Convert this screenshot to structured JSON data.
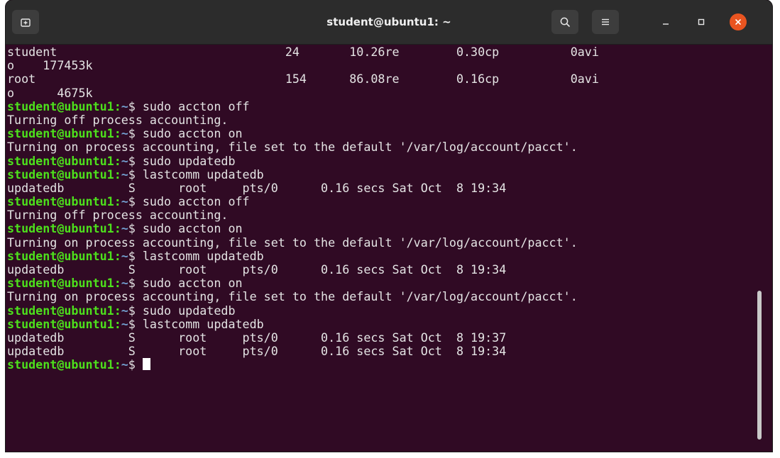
{
  "window": {
    "title": "student@ubuntu1: ~",
    "icons": {
      "new_tab": "new-tab-icon",
      "search": "search-icon",
      "menu": "hamburger-menu-icon",
      "minimize": "minimize-icon",
      "maximize": "maximize-icon",
      "close": "close-icon"
    }
  },
  "colors": {
    "terminal_bg": "#300a24",
    "prompt_user": "#4de01c",
    "prompt_path": "#729fcf",
    "close_button": "#e95420",
    "text": "#e4e4e4"
  },
  "prompt": {
    "user_host": "student@ubuntu1",
    "colon": ":",
    "path": "~",
    "symbol": "$ "
  },
  "lines": [
    {
      "type": "output",
      "text": "student                                24       10.26re        0.30cp          0avi"
    },
    {
      "type": "output",
      "text": "o    177453k"
    },
    {
      "type": "output",
      "text": "root                                   154      86.08re        0.16cp          0avi"
    },
    {
      "type": "output",
      "text": "o      4675k"
    },
    {
      "type": "cmd",
      "text": "sudo accton off"
    },
    {
      "type": "output",
      "text": "Turning off process accounting."
    },
    {
      "type": "cmd",
      "text": "sudo accton on"
    },
    {
      "type": "output",
      "text": "Turning on process accounting, file set to the default '/var/log/account/pacct'."
    },
    {
      "type": "cmd",
      "text": "sudo updatedb"
    },
    {
      "type": "cmd",
      "text": "lastcomm updatedb"
    },
    {
      "type": "output",
      "text": "updatedb         S      root     pts/0      0.16 secs Sat Oct  8 19:34"
    },
    {
      "type": "cmd",
      "text": "sudo accton off"
    },
    {
      "type": "output",
      "text": "Turning off process accounting."
    },
    {
      "type": "cmd",
      "text": "sudo accton on"
    },
    {
      "type": "output",
      "text": "Turning on process accounting, file set to the default '/var/log/account/pacct'."
    },
    {
      "type": "cmd",
      "text": "lastcomm updatedb"
    },
    {
      "type": "output",
      "text": "updatedb         S      root     pts/0      0.16 secs Sat Oct  8 19:34"
    },
    {
      "type": "cmd",
      "text": "sudo accton on"
    },
    {
      "type": "output",
      "text": "Turning on process accounting, file set to the default '/var/log/account/pacct'."
    },
    {
      "type": "cmd",
      "text": "sudo updatedb"
    },
    {
      "type": "cmd",
      "text": "lastcomm updatedb"
    },
    {
      "type": "output",
      "text": "updatedb         S      root     pts/0      0.16 secs Sat Oct  8 19:37"
    },
    {
      "type": "output",
      "text": "updatedb         S      root     pts/0      0.16 secs Sat Oct  8 19:34"
    },
    {
      "type": "cmd",
      "text": "",
      "cursor": true
    }
  ]
}
